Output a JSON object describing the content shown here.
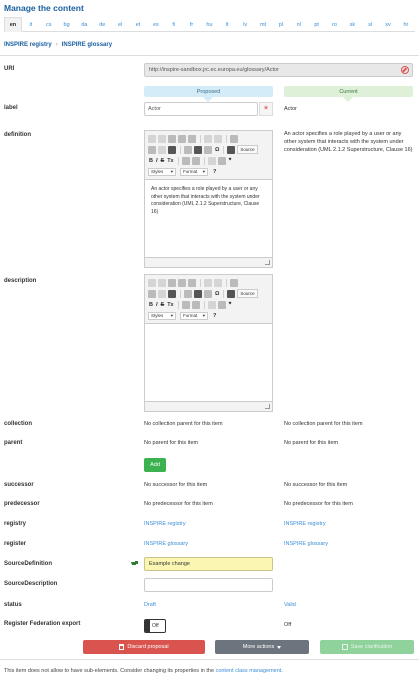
{
  "title": "Manage the content",
  "languages": [
    "en",
    "it",
    "cs",
    "bg",
    "da",
    "de",
    "el",
    "et",
    "es",
    "fi",
    "fr",
    "hu",
    "lt",
    "lv",
    "mt",
    "pl",
    "nl",
    "pt",
    "ro",
    "sk",
    "sl",
    "sv",
    "hr"
  ],
  "active_language": "en",
  "breadcrumb": [
    "INSPIRE registry",
    "INSPIRE glossary"
  ],
  "labels": {
    "uri": "URI",
    "label": "label",
    "definition": "definition",
    "description": "description",
    "collection": "collection",
    "parent": "parent",
    "successor": "successor",
    "predecessor": "predecessor",
    "registry": "registry",
    "register": "register",
    "source_definition": "SourceDefinition",
    "source_description": "SourceDescription",
    "status": "status",
    "federation_export": "Register Federation export"
  },
  "uri_value": "http://inspire-sandbox.jrc.ec.europa.eu/glossary/Actor",
  "column_headers": {
    "proposed": "Proposed",
    "current": "Current"
  },
  "proposed": {
    "label": "Actor",
    "definition": "An actor specifies a role played by a user or any other system that interacts with the system under consideration (UML 2.1.2 Superstructure, Clause 16)",
    "collection": "No collection parent for this item",
    "parent": "No parent for this item",
    "add_button": "Add",
    "successor": "No successor for this item",
    "predecessor": "No predecessor for this item",
    "registry": "INSPIRE registry",
    "register": "INSPIRE glossary",
    "source_definition": "Example change",
    "source_description": "",
    "status": "Draft",
    "federation_export": "Off"
  },
  "current": {
    "label": "Actor",
    "definition": "An actor specifies a role played by a user or any other system that interacts with the system under consideration (UML 2.1.2 Superstructure, Clause 16)",
    "collection": "No collection parent for this item",
    "parent": "No parent for this item",
    "successor": "No successor for this item",
    "predecessor": "No predecessor for this item",
    "registry": "INSPIRE registry",
    "register": "INSPIRE glossary",
    "status": "Valid",
    "federation_export": "Off"
  },
  "editor": {
    "source_label": "Source",
    "styles_label": "Styles",
    "format_label": "Format",
    "bold": "B",
    "italic": "I",
    "strike": "S",
    "removeformat": "Tx",
    "quote": "❞",
    "help": "?"
  },
  "buttons": {
    "discard": "Discard proposal",
    "more": "More actions",
    "save": "Save clarification"
  },
  "footer": {
    "text": "This item does not allow to have sub-elements. Consider changing its properties in the",
    "link": "content class management",
    "end": "."
  },
  "colors": {
    "brand": "#1a5fa0",
    "link": "#3b8ed6",
    "danger": "#d9534f",
    "success": "#3cb150",
    "proposed_header": "#d4ecf7",
    "current_header": "#dff0d8",
    "highlight": "#fbf7b3"
  }
}
